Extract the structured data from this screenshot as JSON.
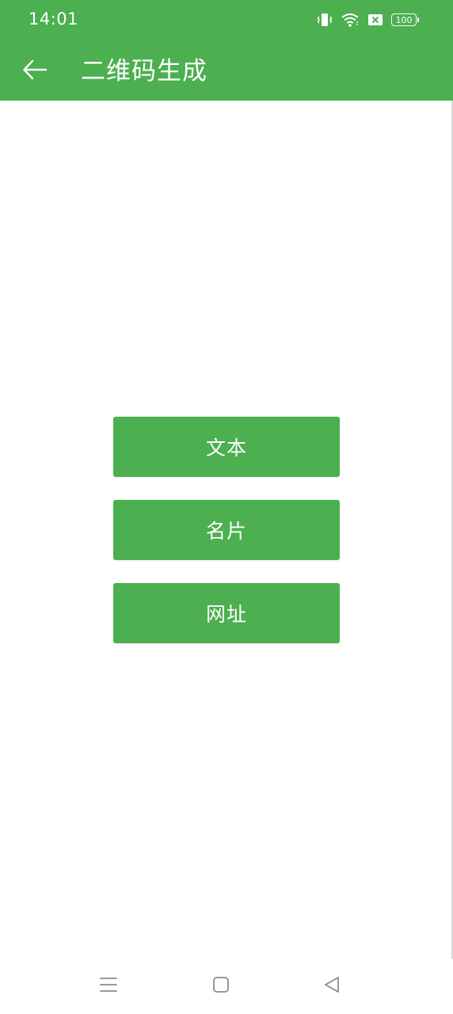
{
  "status_bar": {
    "time": "14:01",
    "battery": "100",
    "icons": [
      "vibrate-icon",
      "wifi-icon",
      "sim-off-icon",
      "battery-icon"
    ]
  },
  "app_bar": {
    "title": "二维码生成",
    "back_icon": "arrow-left-icon"
  },
  "buttons": {
    "text_label": "文本",
    "card_label": "名片",
    "url_label": "网址"
  },
  "nav_bar": {
    "icons": [
      "menu-icon",
      "home-icon",
      "back-triangle-icon"
    ]
  },
  "colors": {
    "primary": "#4caf50",
    "on_primary": "#ffffff",
    "background": "#ffffff",
    "nav_icon": "#8a8a8a"
  }
}
